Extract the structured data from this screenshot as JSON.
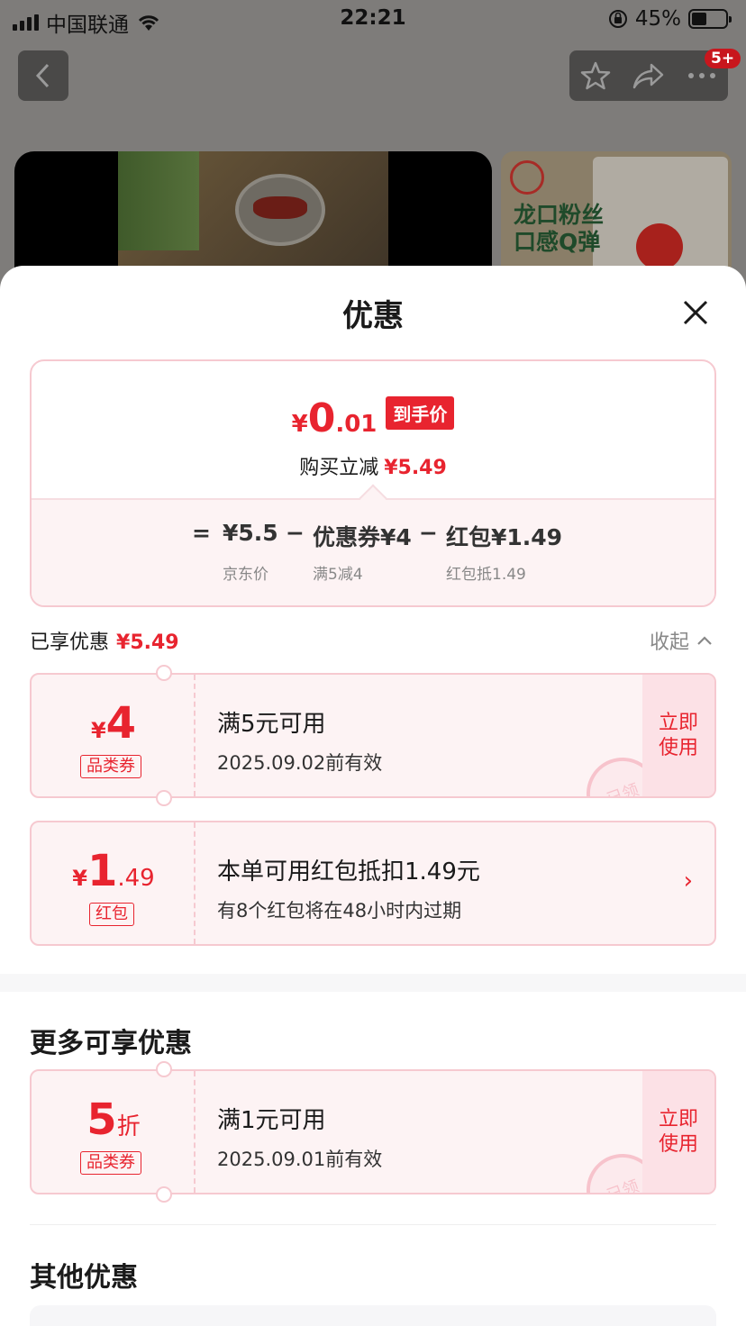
{
  "status_bar": {
    "carrier": "中国联通",
    "time": "22:21",
    "battery": "45%",
    "battery_level": 0.45
  },
  "nav": {
    "badge": "5+"
  },
  "product_banner": {
    "line1": "龙口粉丝",
    "line2": "口感Q弹"
  },
  "sheet": {
    "title": "优惠"
  },
  "price_card": {
    "yen": "¥",
    "price_int": "0",
    "price_dec": ".01",
    "tag": "到手价",
    "reduce_label": "购买立减",
    "reduce_amount": "¥5.49",
    "formula": {
      "eq": "=",
      "jd_price": "¥5.5",
      "minus1": "−",
      "coupon_part": "优惠券¥4",
      "minus2": "−",
      "redpacket_part": "红包¥1.49",
      "jd_price_label": "京东价",
      "coupon_label": "满5减4",
      "redpacket_label": "红包抵1.49"
    }
  },
  "enjoyed": {
    "label": "已享优惠",
    "amount": "¥5.49",
    "collapse_label": "收起"
  },
  "coupons_enjoyed": [
    {
      "yen": "¥",
      "value": "4",
      "type": "品类券",
      "condition": "满5元可用",
      "validity": "2025.09.02前有效",
      "action": "立即使用",
      "stamp": "已领"
    },
    {
      "yen": "¥",
      "value": "1",
      "decimal": ".49",
      "type": "红包",
      "condition": "本单可用红包抵扣1.49元",
      "validity": "有8个红包将在48小时内过期"
    }
  ],
  "more_section": {
    "title": "更多可享优惠",
    "coupon": {
      "value": "5",
      "unit": "折",
      "type": "品类券",
      "condition": "满1元可用",
      "validity": "2025.09.01前有效",
      "action": "立即使用",
      "stamp": "已领"
    }
  },
  "other_section": {
    "title": "其他优惠"
  },
  "colors": {
    "accent": "#e8242f",
    "card_bg": "#fdf3f4",
    "card_border": "#f6c9d0"
  }
}
